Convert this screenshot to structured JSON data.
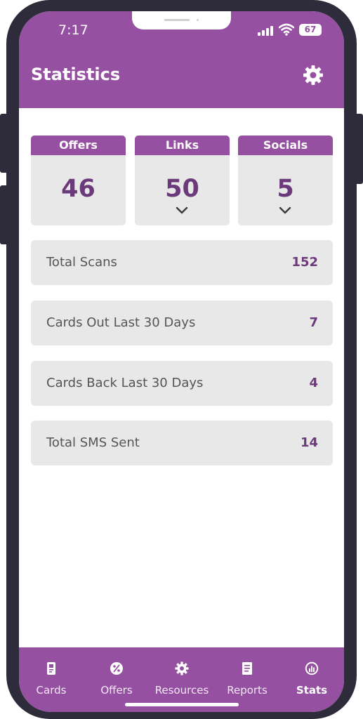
{
  "status_bar": {
    "time": "7:17",
    "battery": "67"
  },
  "header": {
    "title": "Statistics"
  },
  "stat_cards": [
    {
      "label": "Offers",
      "value": "46",
      "expandable": false
    },
    {
      "label": "Links",
      "value": "50",
      "expandable": true
    },
    {
      "label": "Socials",
      "value": "5",
      "expandable": true
    }
  ],
  "rows": [
    {
      "label": "Total Scans",
      "value": "152"
    },
    {
      "label": "Cards Out Last 30 Days",
      "value": "7"
    },
    {
      "label": "Cards Back Last 30 Days",
      "value": "4"
    },
    {
      "label": "Total SMS Sent",
      "value": "14"
    }
  ],
  "tabs": [
    {
      "label": "Cards",
      "icon": "card-icon"
    },
    {
      "label": "Offers",
      "icon": "percent-icon"
    },
    {
      "label": "Resources",
      "icon": "gear-icon"
    },
    {
      "label": "Reports",
      "icon": "document-icon"
    },
    {
      "label": "Stats",
      "icon": "stats-icon",
      "active": true
    }
  ],
  "colors": {
    "brand": "#9650a1",
    "value_text": "#6c3a7b",
    "card_bg": "#e8e8e8",
    "frame": "#2e2c3b"
  }
}
